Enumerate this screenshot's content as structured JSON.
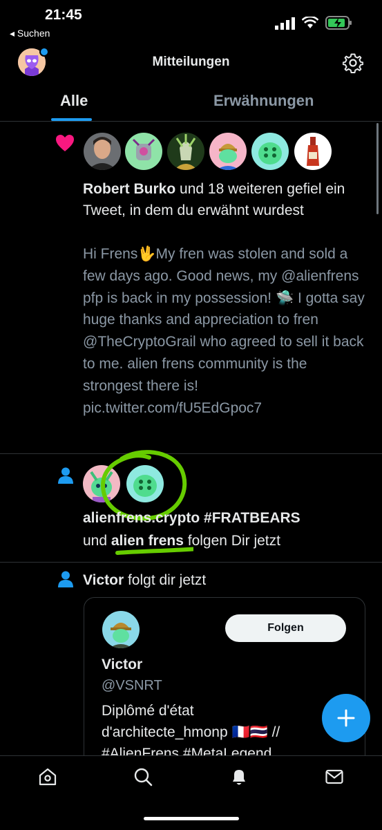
{
  "status": {
    "time": "21:45",
    "back_label": "◂ Suchen"
  },
  "header": {
    "title": "Mitteilungen"
  },
  "tabs": [
    {
      "label": "Alle"
    },
    {
      "label": "Erwähnungen"
    }
  ],
  "notifications": [
    {
      "kind": "like",
      "actor": "Robert Burko",
      "summary": " und 18 weiteren gefiel ein Tweet, in dem du erwähnt wurdest",
      "body": "Hi Frens🖖My fren was stolen and sold a few days ago. Good news, my @alienfrens pfp is back in my possession! 🛸 I gotta say huge thanks and appreciation to fren @TheCryptoGrail who agreed to sell it back to me. alien frens community is the strongest there is! pic.twitter.com/fU5EdGpoc7"
    },
    {
      "kind": "follow",
      "line1": "alienfrens.crypto #FRATBEARS",
      "and_word": "und ",
      "actor": "alien frens",
      "suffix": " folgen Dir jetzt"
    },
    {
      "kind": "follow",
      "actor": "Victor",
      "suffix": " folgt dir jetzt",
      "card": {
        "follow_label": "Folgen",
        "name": "Victor",
        "handle": "@VSNRT",
        "bio": "Diplômé d'état d'architecte_hmonp 🇫🇷🇹🇭 // #AlienFrens #MetaLegend"
      }
    }
  ],
  "colors": {
    "accent": "#1d9bf0",
    "like": "#f91880",
    "annotation": "#66cc00"
  },
  "icons": [
    "heart-icon",
    "person-icon",
    "gear-icon",
    "compose-plus-icon",
    "home-icon",
    "search-icon",
    "bell-icon",
    "mail-icon"
  ]
}
